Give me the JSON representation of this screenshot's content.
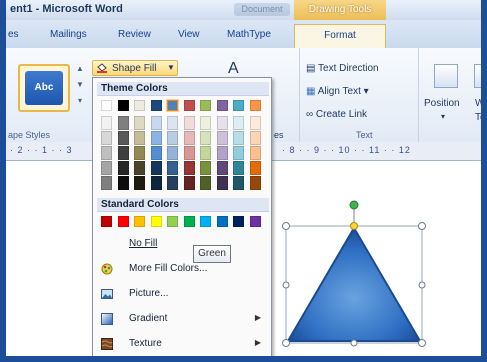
{
  "window": {
    "title": "ent1 - Microsoft Word",
    "doc_tab": "Document"
  },
  "contextual": {
    "group_label": "Drawing Tools",
    "tab_label": "Format"
  },
  "tabs": [
    {
      "label": "es"
    },
    {
      "label": "Mailings"
    },
    {
      "label": "Review"
    },
    {
      "label": "View"
    },
    {
      "label": "MathType"
    }
  ],
  "ribbon": {
    "style_preview": "Abc",
    "shape_styles_label": "ape Styles",
    "shape_fill_label": "Shape Fill",
    "text_direction": "Text Direction",
    "align_text": "Align Text",
    "create_link": "Create Link",
    "text_group_label": "Text",
    "position_label": "Position",
    "wrap_text_label": "Wra",
    "wrap_text_label2": "Tex",
    "faded_a": "A",
    "faded_es": "es"
  },
  "ruler": {
    "left": "· 2 · · 1 · · 3",
    "right": "· 8 · · 9 · · 10 · · 11 · · 12"
  },
  "dropdown": {
    "theme_colors_label": "Theme Colors",
    "standard_colors_label": "Standard Colors",
    "theme_top": [
      "#ffffff",
      "#000000",
      "#eeece1",
      "#1f497d",
      "#4f81bd",
      "#c0504d",
      "#9bbb59",
      "#8064a2",
      "#4bacc6",
      "#f79646"
    ],
    "theme_shades": [
      [
        "#f2f2f2",
        "#d8d8d8",
        "#bfbfbf",
        "#a5a5a5",
        "#7f7f7f"
      ],
      [
        "#7f7f7f",
        "#595959",
        "#3f3f3f",
        "#262626",
        "#0d0d0d"
      ],
      [
        "#ddd9c3",
        "#c4bd97",
        "#938953",
        "#494429",
        "#1d1b10"
      ],
      [
        "#c6d9f0",
        "#8db3e2",
        "#548dd4",
        "#17365d",
        "#0f243e"
      ],
      [
        "#dbe5f1",
        "#b8cce4",
        "#95b3d7",
        "#366092",
        "#244061"
      ],
      [
        "#f2dcdb",
        "#e5b9b7",
        "#d99694",
        "#953734",
        "#632423"
      ],
      [
        "#ebf1dd",
        "#d7e3bc",
        "#c3d69b",
        "#76923c",
        "#4f6128"
      ],
      [
        "#e5e0ec",
        "#ccc1d9",
        "#b2a2c7",
        "#5f497a",
        "#3f3151"
      ],
      [
        "#dbeef3",
        "#b7dde8",
        "#92cddc",
        "#31859b",
        "#205867"
      ],
      [
        "#fdeada",
        "#fbd5b5",
        "#fac08f",
        "#e36c09",
        "#974806"
      ]
    ],
    "standard": [
      "#c00000",
      "#ff0000",
      "#ffc000",
      "#ffff00",
      "#92d050",
      "#00b050",
      "#00b0f0",
      "#0070c0",
      "#002060",
      "#7030a0"
    ],
    "no_fill": "No Fill",
    "more_fill_colors": "More Fill Colors...",
    "picture": "Picture...",
    "gradient": "Gradient",
    "texture": "Texture"
  },
  "tooltip": "Green"
}
